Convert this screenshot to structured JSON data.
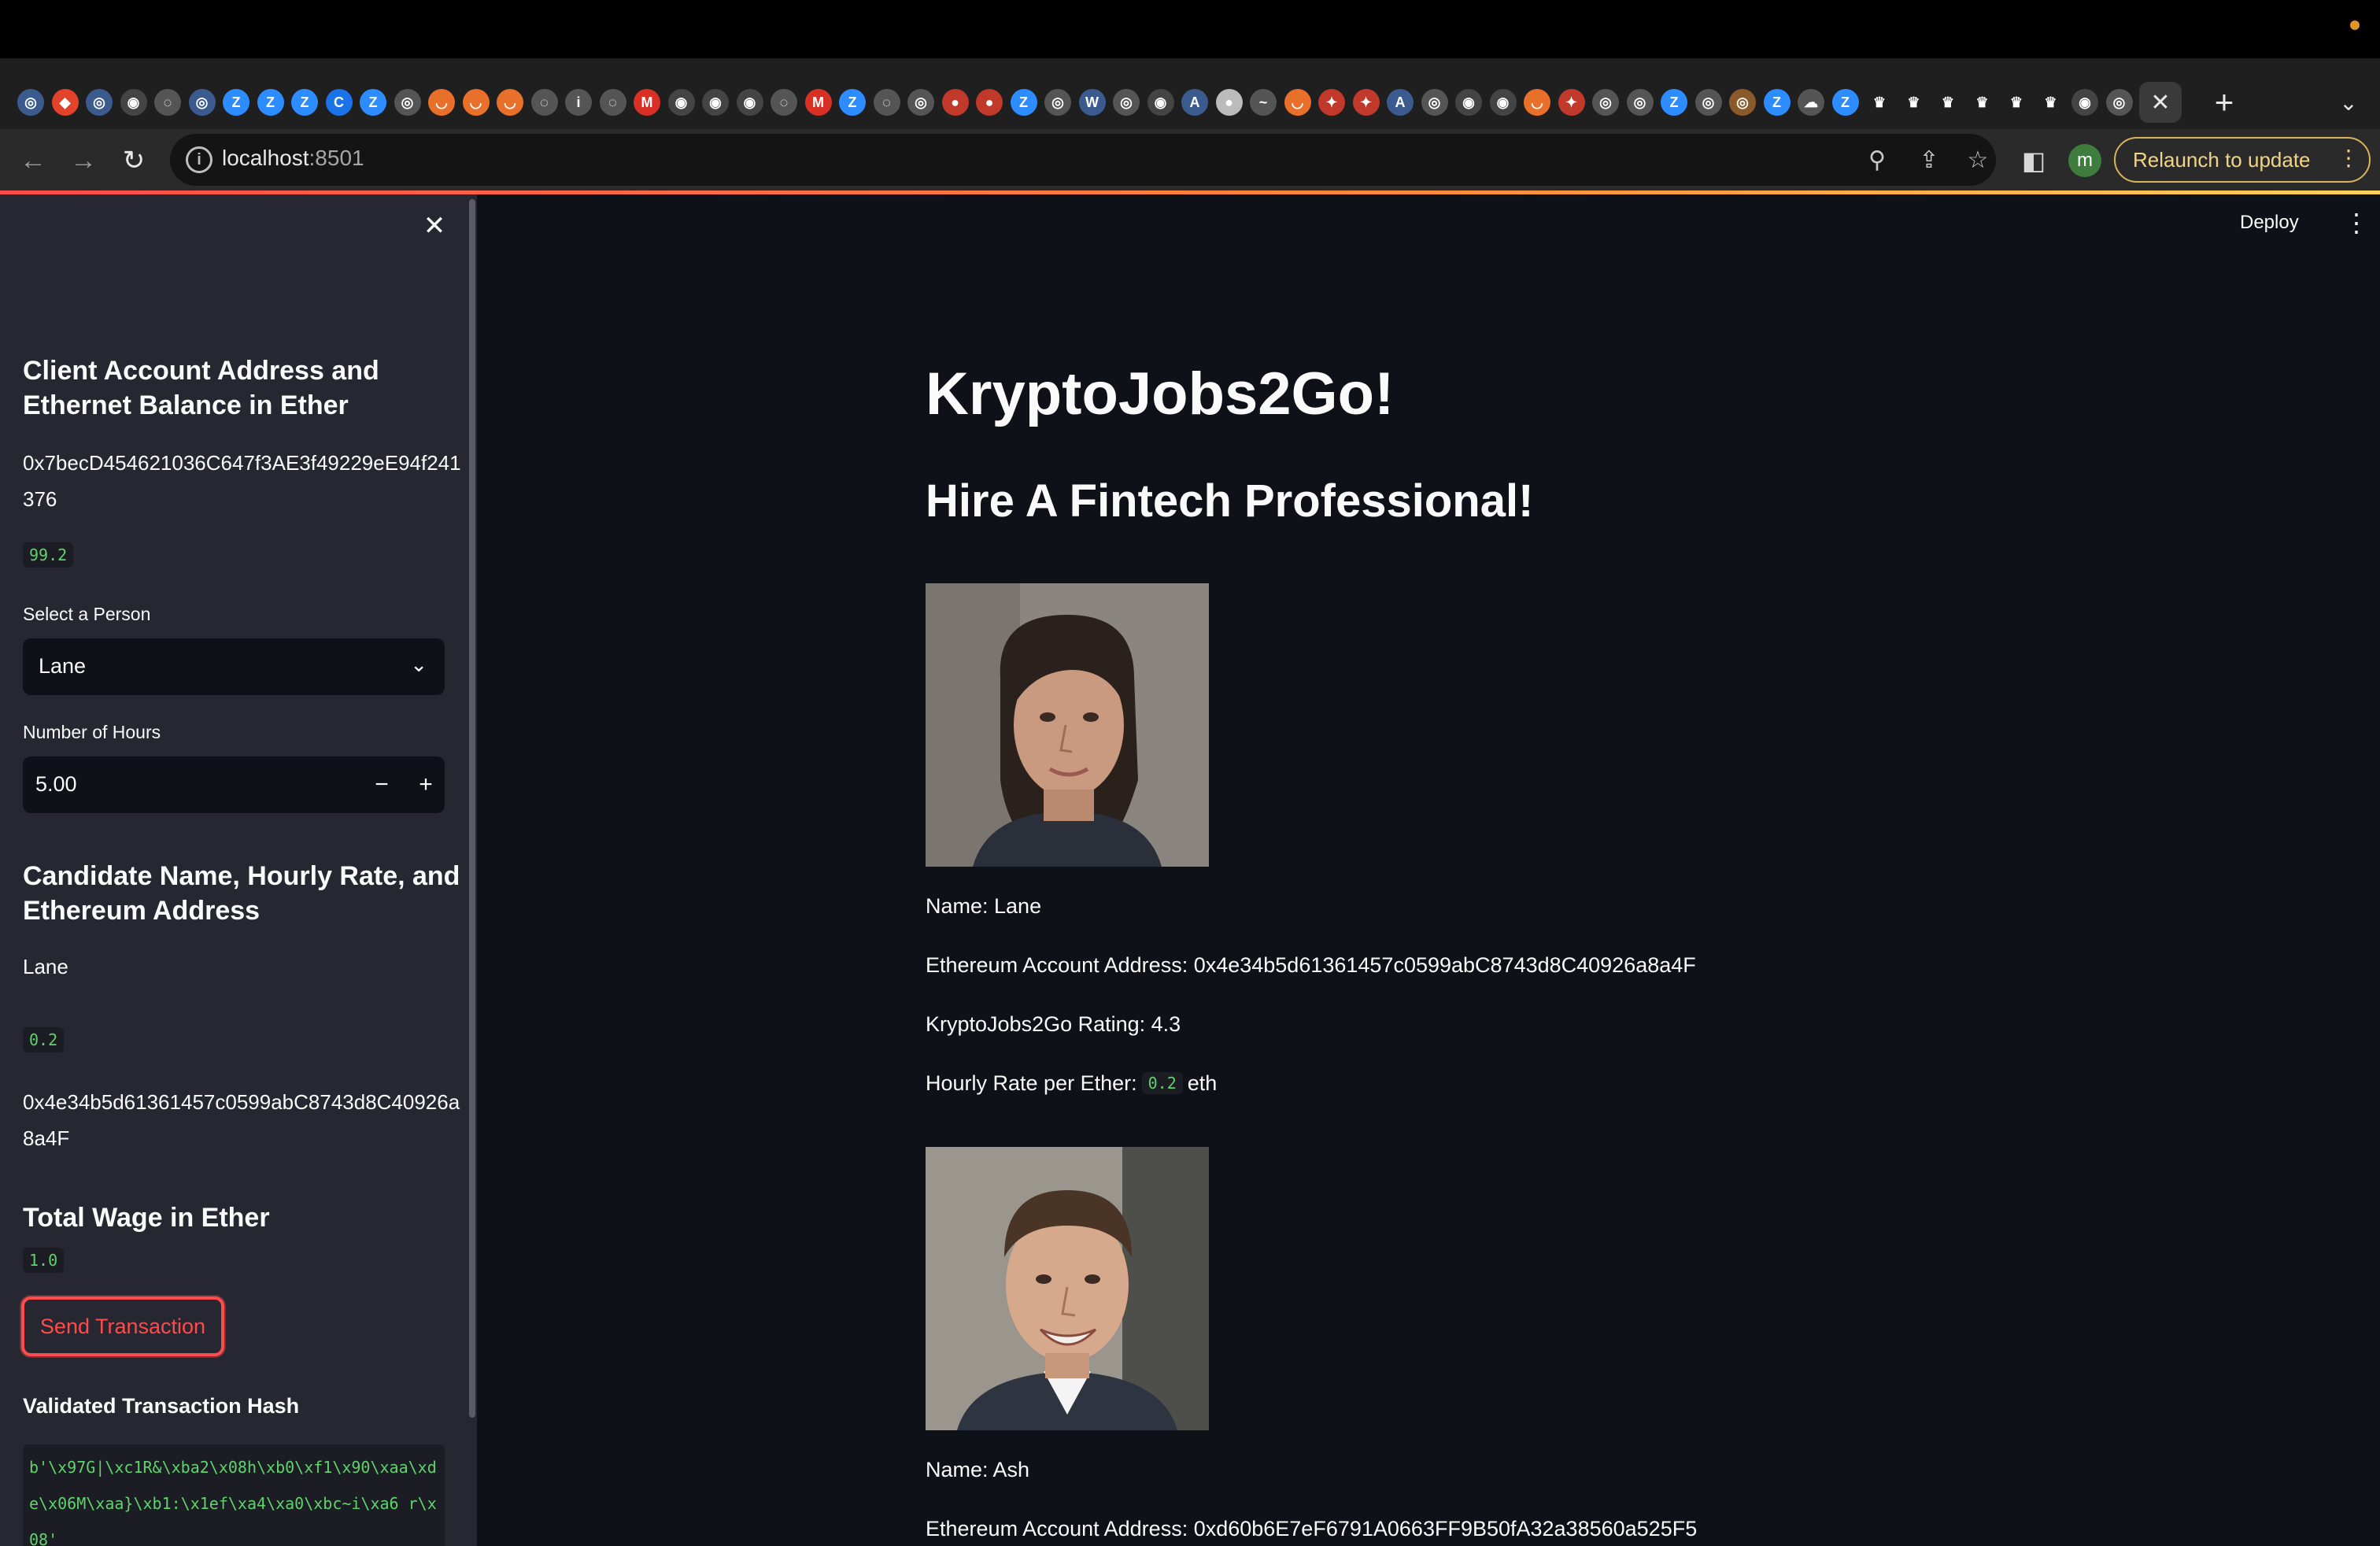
{
  "browser": {
    "tab_favicons": [
      {
        "icon": "globe-icon",
        "color": "#3b5b8f",
        "glyph": "◎"
      },
      {
        "icon": "gitlab-icon",
        "color": "#e2432a",
        "glyph": "◆"
      },
      {
        "icon": "globe-icon",
        "color": "#3b5b8f",
        "glyph": "◎"
      },
      {
        "icon": "github-icon",
        "color": "#444",
        "glyph": "◉"
      },
      {
        "icon": "dil-icon",
        "color": "#555",
        "glyph": "◌"
      },
      {
        "icon": "globe-icon",
        "color": "#3b5b8f",
        "glyph": "◎"
      },
      {
        "icon": "zoom-icon",
        "color": "#2d8cff",
        "glyph": "Z"
      },
      {
        "icon": "zoom-icon",
        "color": "#2d8cff",
        "glyph": "Z"
      },
      {
        "icon": "zoom-icon",
        "color": "#2d8cff",
        "glyph": "Z"
      },
      {
        "icon": "chrome-icon",
        "color": "#1a73e8",
        "glyph": "C"
      },
      {
        "icon": "zoom-icon",
        "color": "#2d8cff",
        "glyph": "Z"
      },
      {
        "icon": "chrome-icon",
        "color": "#555",
        "glyph": "◎"
      },
      {
        "icon": "pluralsight-icon",
        "color": "#e8702a",
        "glyph": "◡"
      },
      {
        "icon": "pluralsight-icon",
        "color": "#e8702a",
        "glyph": "◡"
      },
      {
        "icon": "pluralsight-icon",
        "color": "#e8702a",
        "glyph": "◡"
      },
      {
        "icon": "dil-icon",
        "color": "#555",
        "glyph": "◌"
      },
      {
        "icon": "info-icon",
        "color": "#555",
        "glyph": "i"
      },
      {
        "icon": "dil-icon",
        "color": "#555",
        "glyph": "◌"
      },
      {
        "icon": "gmail-icon",
        "color": "#d93025",
        "glyph": "M"
      },
      {
        "icon": "github-icon",
        "color": "#444",
        "glyph": "◉"
      },
      {
        "icon": "github-icon",
        "color": "#444",
        "glyph": "◉"
      },
      {
        "icon": "github-icon",
        "color": "#444",
        "glyph": "◉"
      },
      {
        "icon": "dil-icon",
        "color": "#555",
        "glyph": "◌"
      },
      {
        "icon": "gmail-icon",
        "color": "#d93025",
        "glyph": "M"
      },
      {
        "icon": "zoom-icon",
        "color": "#2d8cff",
        "glyph": "Z"
      },
      {
        "icon": "dil-icon",
        "color": "#555",
        "glyph": "◌"
      },
      {
        "icon": "globe-icon",
        "color": "#555",
        "glyph": "◎"
      },
      {
        "icon": "record-icon",
        "color": "#c0392b",
        "glyph": "●"
      },
      {
        "icon": "record-icon",
        "color": "#c0392b",
        "glyph": "●"
      },
      {
        "icon": "zoom-icon",
        "color": "#2d8cff",
        "glyph": "Z"
      },
      {
        "icon": "globe-icon",
        "color": "#555",
        "glyph": "◎"
      },
      {
        "icon": "wordpress-icon",
        "color": "#3b5b8f",
        "glyph": "W"
      },
      {
        "icon": "globe-icon",
        "color": "#555",
        "glyph": "◎"
      },
      {
        "icon": "github-icon",
        "color": "#444",
        "glyph": "◉"
      },
      {
        "icon": "a-icon",
        "color": "#3b5b8f",
        "glyph": "A"
      },
      {
        "icon": "circle-icon",
        "color": "#bbb",
        "glyph": "●"
      },
      {
        "icon": "wave-icon",
        "color": "#555",
        "glyph": "~"
      },
      {
        "icon": "pluralsight-icon",
        "color": "#e8702a",
        "glyph": "◡"
      },
      {
        "icon": "maple-icon",
        "color": "#c0392b",
        "glyph": "✦"
      },
      {
        "icon": "maple-icon",
        "color": "#c0392b",
        "glyph": "✦"
      },
      {
        "icon": "a-icon",
        "color": "#3b5b8f",
        "glyph": "A"
      },
      {
        "icon": "globe-icon",
        "color": "#555",
        "glyph": "◎"
      },
      {
        "icon": "github-icon",
        "color": "#444",
        "glyph": "◉"
      },
      {
        "icon": "github-icon",
        "color": "#444",
        "glyph": "◉"
      },
      {
        "icon": "pluralsight-icon",
        "color": "#e8702a",
        "glyph": "◡"
      },
      {
        "icon": "maple-icon",
        "color": "#c0392b",
        "glyph": "✦"
      },
      {
        "icon": "chrome-icon",
        "color": "#555",
        "glyph": "◎"
      },
      {
        "icon": "globe-icon",
        "color": "#555",
        "glyph": "◎"
      },
      {
        "icon": "zoom-icon",
        "color": "#2d8cff",
        "glyph": "Z"
      },
      {
        "icon": "chrome-icon",
        "color": "#555",
        "glyph": "◎"
      },
      {
        "icon": "globe-icon",
        "color": "#8a5a2b",
        "glyph": "◎"
      },
      {
        "icon": "zoom-icon",
        "color": "#2d8cff",
        "glyph": "Z"
      },
      {
        "icon": "cloud-icon",
        "color": "#555",
        "glyph": "☁"
      },
      {
        "icon": "zoom-icon",
        "color": "#2d8cff",
        "glyph": "Z"
      },
      {
        "icon": "crown-icon",
        "color": "#1f1f1f",
        "glyph": "♛"
      },
      {
        "icon": "crown-icon",
        "color": "#1f1f1f",
        "glyph": "♛"
      },
      {
        "icon": "crown-icon",
        "color": "#1f1f1f",
        "glyph": "♛"
      },
      {
        "icon": "crown-icon",
        "color": "#1f1f1f",
        "glyph": "♛"
      },
      {
        "icon": "crown-icon",
        "color": "#1f1f1f",
        "glyph": "♛"
      },
      {
        "icon": "crown-icon",
        "color": "#1f1f1f",
        "glyph": "♛"
      },
      {
        "icon": "github-icon",
        "color": "#444",
        "glyph": "◉"
      },
      {
        "icon": "globe-icon",
        "color": "#555",
        "glyph": "◎"
      }
    ],
    "active_tab_close": "✕",
    "new_tab": "+",
    "tab_menu": "⌄",
    "url_host": "localhost",
    "url_port": ":8501",
    "relaunch_label": "Relaunch to update",
    "profile_initial": "m"
  },
  "app": {
    "deploy_label": "Deploy",
    "title": "KryptoJobs2Go!",
    "subtitle": "Hire A Fintech Professional!"
  },
  "sidebar": {
    "account_heading": "Client Account Address and Ethernet Balance in Ether",
    "account_address": "0x7becD454621036C647f3AE3f49229eE94f241376",
    "balance": "99.2",
    "select_label": "Select a Person",
    "selected_person": "Lane",
    "hours_label": "Number of Hours",
    "hours_value": "5.00",
    "candidate_heading": "Candidate Name, Hourly Rate, and Ethereum Address",
    "candidate_name": "Lane",
    "candidate_rate": "0.2",
    "candidate_address": "0x4e34b5d61361457c0599abC8743d8C40926a8a4F",
    "wage_heading": "Total Wage in Ether",
    "wage_value": "1.0",
    "send_label": "Send Transaction",
    "hash_heading": "Validated Transaction Hash",
    "hash_value": "b'\\x97G|\\xc1R&\\xba2\\x08h\\xb0\\xf1\\x90\\xaa\\xde\\x06M\\xaa}\\xb1:\\x1ef\\xa4\\xa0\\xbc~i\\xa6 r\\x08'"
  },
  "candidates": [
    {
      "name_line": "Name: Lane",
      "address_line": "Ethereum Account Address: 0x4e34b5d61361457c0599abC8743d8C40926a8a4F",
      "rating_line": "KryptoJobs2Go Rating: 4.3",
      "rate_prefix": "Hourly Rate per Ether:",
      "rate_value": "0.2",
      "rate_suffix": "eth"
    },
    {
      "name_line": "Name: Ash",
      "address_line": "Ethereum Account Address: 0xd60b6E7eF6791A0663FF9B50fA32a38560a525F5"
    }
  ]
}
